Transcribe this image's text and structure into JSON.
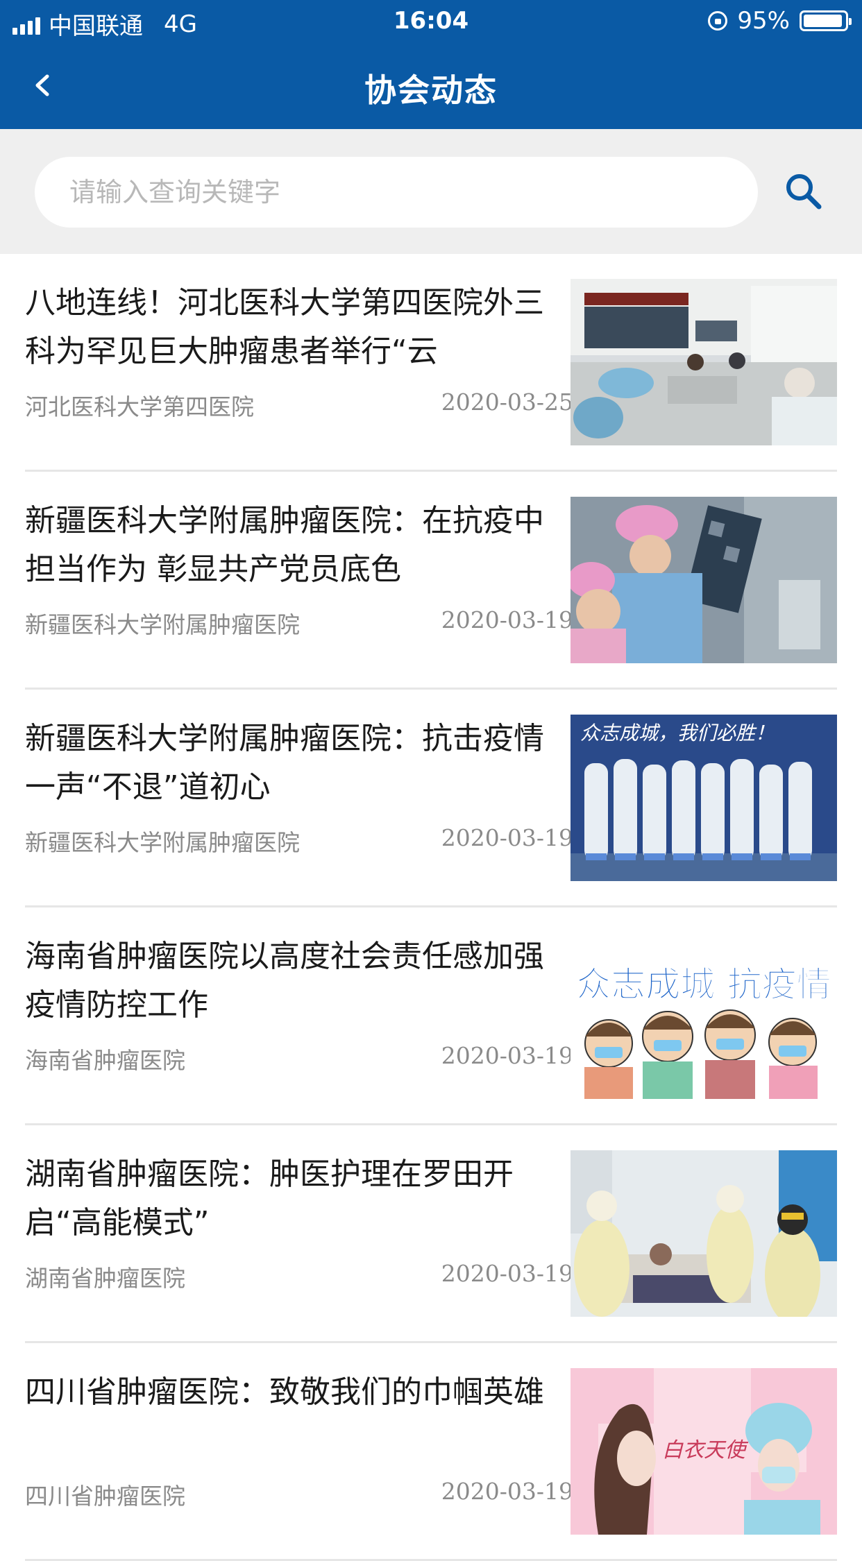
{
  "status_bar": {
    "carrier": "中国联通",
    "network": "4G",
    "time": "16:04",
    "battery": "95%",
    "battery_level": 0.95
  },
  "nav": {
    "title": "协会动态",
    "back_icon": "chevron-left-icon"
  },
  "search": {
    "placeholder": "请输入查询关键字",
    "value": "",
    "icon": "search-icon"
  },
  "colors": {
    "brand": "#0a5aa5",
    "search_bg": "#efefef",
    "meta_text": "#8a8a8a"
  },
  "news": [
    {
      "title": "八地连线！河北医科大学第四医院外三科为罕见巨大肿瘤患者举行“云",
      "source": "河北医科大学第四医院",
      "date": "2020-03-25",
      "thumbnail": "remote-consultation-meeting"
    },
    {
      "title": "新疆医科大学附属肿瘤医院：在抗疫中担当作为 彰显共产党员底色",
      "source": "新疆医科大学附属肿瘤医院",
      "date": "2020-03-19",
      "thumbnail": "doctors-reviewing-ct-scan"
    },
    {
      "title": "新疆医科大学附属肿瘤医院：抗击疫情 一声“不退”道初心",
      "source": "新疆医科大学附属肿瘤医院",
      "date": "2020-03-19",
      "thumbnail": "medical-team-in-protective-suits",
      "thumbnail_text": "众志成城，我们必胜！"
    },
    {
      "title": "海南省肿瘤医院以高度社会责任感加强疫情防控工作",
      "source": "海南省肿瘤医院",
      "date": "2020-03-19",
      "thumbnail": "cartoon-masked-people-poster",
      "thumbnail_text": "众志成城 抗疫情"
    },
    {
      "title": "湖南省肿瘤医院：肿医护理在罗田开启“高能模式”",
      "source": "湖南省肿瘤医院",
      "date": "2020-03-19",
      "thumbnail": "nurses-caring-for-patient"
    },
    {
      "title": "四川省肿瘤医院：致敬我们的巾帼英雄",
      "source": "四川省肿瘤医院",
      "date": "2020-03-19",
      "thumbnail": "white-angel-nurse-illustration",
      "thumbnail_text": "白衣天使"
    }
  ]
}
